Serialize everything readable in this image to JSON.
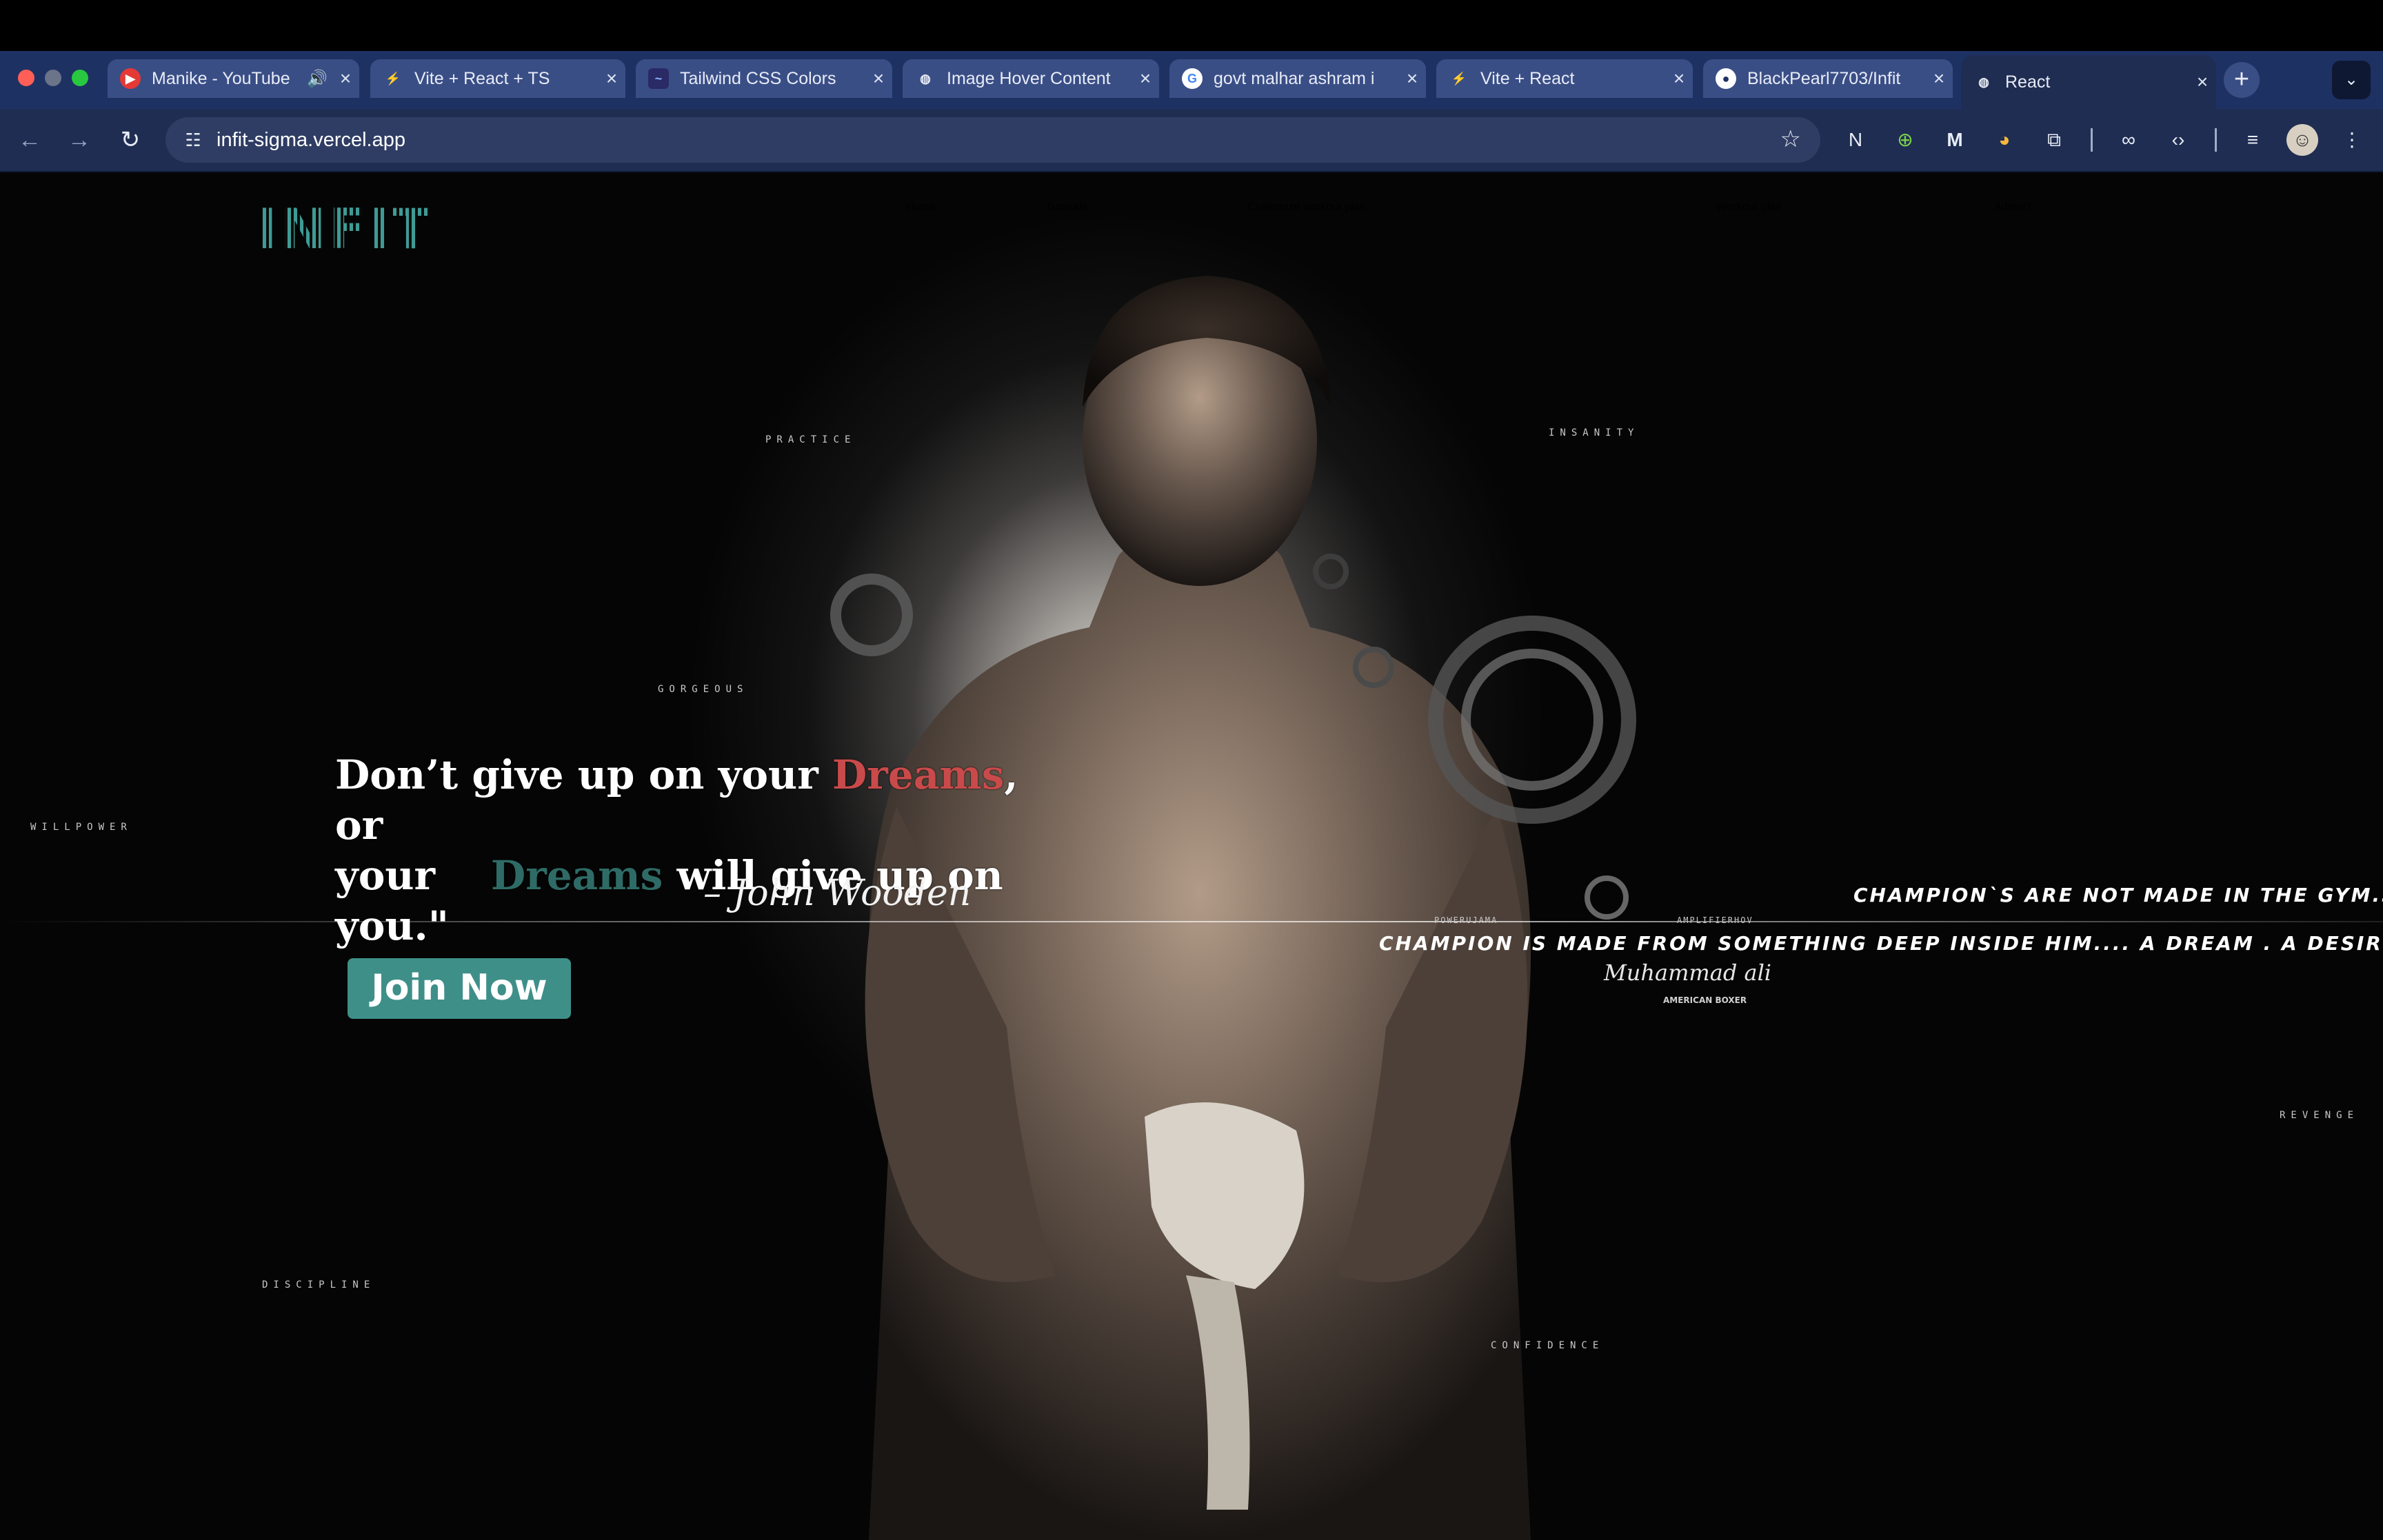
{
  "browser": {
    "tabs": [
      {
        "title": "Manike - YouTube",
        "icon": "youtube-icon"
      },
      {
        "title": "Vite + React + TS",
        "icon": "vite-icon"
      },
      {
        "title": "Tailwind CSS Colors",
        "icon": "tailwind-icon"
      },
      {
        "title": "Image Hover Content",
        "icon": "globe-icon"
      },
      {
        "title": "govt malhar ashram i",
        "icon": "google-icon"
      },
      {
        "title": "Vite + React",
        "icon": "vite-icon"
      },
      {
        "title": "BlackPearl7703/Infit",
        "icon": "github-icon"
      },
      {
        "title": "React",
        "icon": "globe-icon"
      }
    ],
    "url": "infit-sigma.vercel.app"
  },
  "site": {
    "logo": "INFIT",
    "nav": [
      "Home",
      "Tutorials",
      "Customize workout plan",
      "Workout plan",
      "Admin?"
    ],
    "words": {
      "practice": "PRACTICE",
      "insanity": "INSANITY",
      "gorgeous": "GORGEOUS",
      "willpower": "WILLPOWER",
      "discipline": "DISCIPLINE",
      "confidence": "CONFIDENCE",
      "revenge": "REVENGE"
    },
    "quote": {
      "part1": "Don’t give up on your ",
      "dreams1": "Dreams",
      "part2": ", or",
      "part3": "your",
      "dreams2": "Dreams",
      "part4": " will give up on",
      "part5": "you.\"",
      "author": "– John Wooden"
    },
    "cta": "Join Now",
    "champion": {
      "line1": "CHAMPION`S ARE NOT MADE IN THE GYM.S",
      "line2": "CHAMPION IS MADE FROM SOMETHING DEEP INSIDE HIM.... A DREAM . A DESIRE . A VISION...!",
      "signature": "Muhammad ali",
      "subtitle": "AMERICAN BOXER",
      "tag_left": "POWERUJAMA",
      "tag_right": "AMPLIFIERHOV"
    }
  },
  "colors": {
    "accent": "#3f8f89",
    "dreams_red": "#c94a4a",
    "dreams_teal": "#2f6b66",
    "tabstrip": "#1e3163"
  }
}
